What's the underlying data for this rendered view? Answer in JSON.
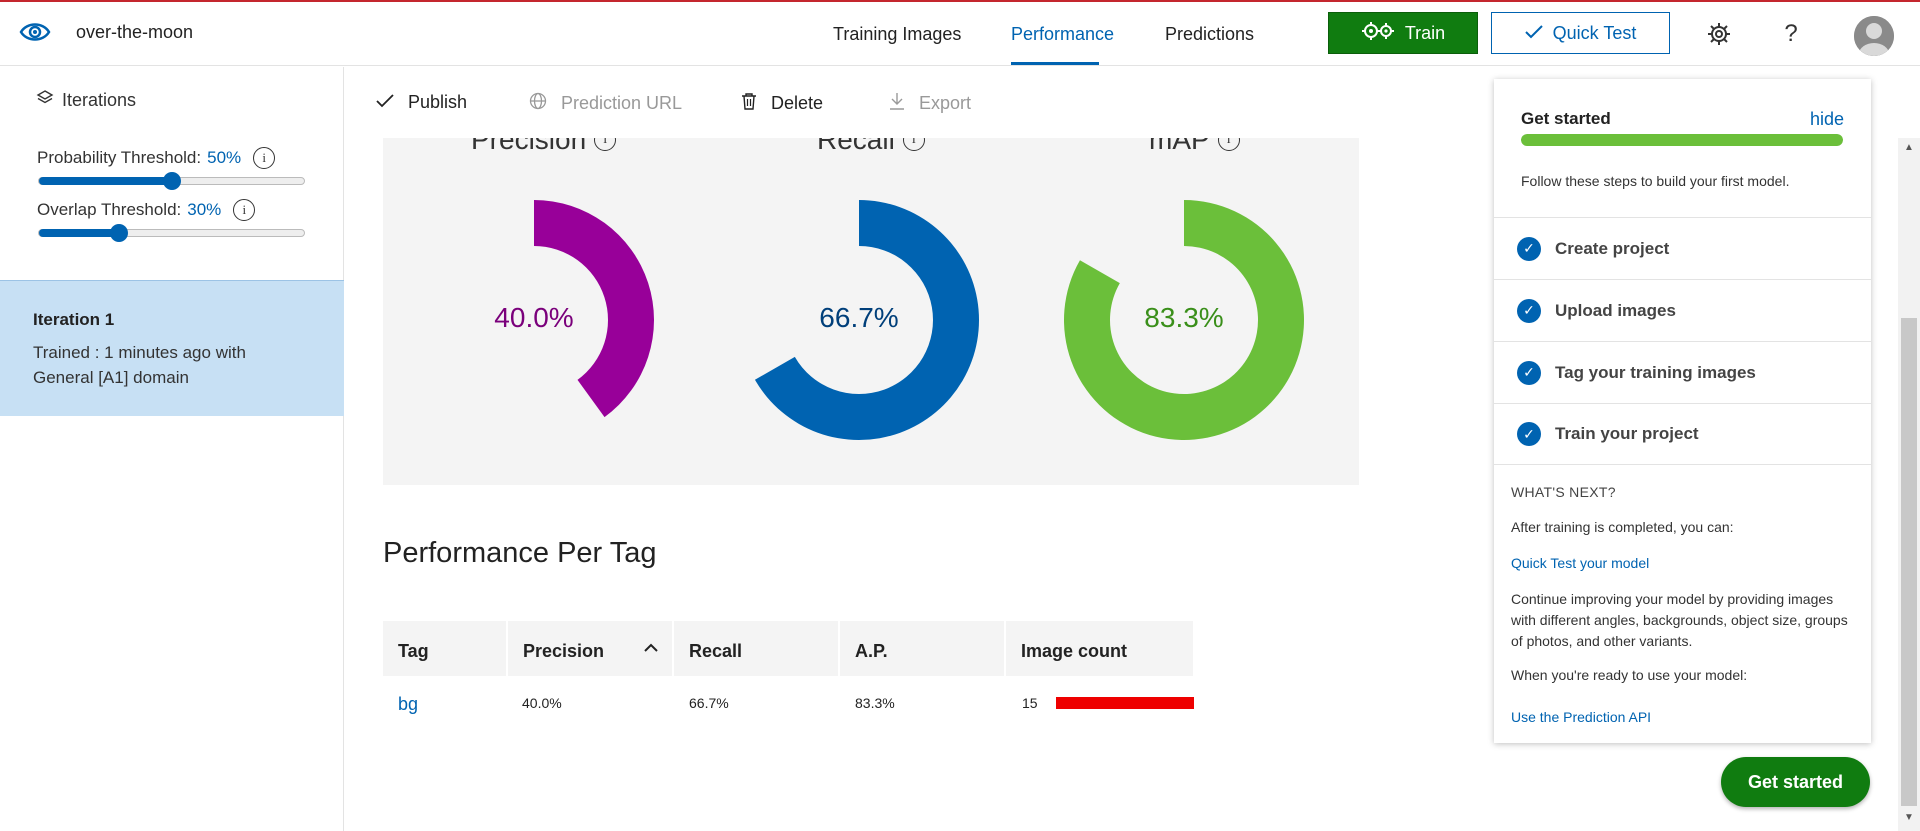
{
  "header": {
    "project_name": "over-the-moon",
    "tabs": [
      {
        "label": "Training Images"
      },
      {
        "label": "Performance"
      },
      {
        "label": "Predictions"
      }
    ],
    "train_label": "Train",
    "quick_test_label": "Quick Test",
    "icons": [
      "eye-logo-icon",
      "gears-icon",
      "check-icon",
      "gear-icon",
      "help-icon",
      "avatar"
    ]
  },
  "sidebar": {
    "iterations_label": "Iterations",
    "probability_label": "Probability Threshold:",
    "probability_value": "50%",
    "probability_level": 0.5,
    "overlap_label": "Overlap Threshold:",
    "overlap_value": "30%",
    "overlap_level": 0.3,
    "iteration": {
      "title": "Iteration 1",
      "subtitle": "Trained : 1 minutes ago with General [A1] domain"
    }
  },
  "toolbar": {
    "publish": "Publish",
    "prediction_url": "Prediction URL",
    "delete": "Delete",
    "export": "Export"
  },
  "metrics": {
    "precision": {
      "title": "Precision",
      "value_label": "40.0%",
      "fraction": 0.4,
      "color": "#980099"
    },
    "recall": {
      "title": "Recall",
      "value_label": "66.7%",
      "fraction": 0.667,
      "color": "#0063b1"
    },
    "map": {
      "title": "mAP",
      "value_label": "83.3%",
      "fraction": 0.833,
      "color": "#6bbf3a"
    }
  },
  "performance_per_tag": {
    "title": "Performance Per Tag",
    "columns": [
      "Tag",
      "Precision",
      "Recall",
      "A.P.",
      "Image count"
    ],
    "rows": [
      {
        "tag": "bg",
        "precision": "40.0%",
        "recall": "66.7%",
        "ap": "83.3%",
        "image_count": "15"
      }
    ]
  },
  "get_started": {
    "title": "Get started",
    "hide_label": "hide",
    "progress": 1.0,
    "description": "Follow these steps to build your first model.",
    "steps": [
      {
        "label": "Create project"
      },
      {
        "label": "Upload images"
      },
      {
        "label": "Tag your training images"
      },
      {
        "label": "Train your project"
      }
    ],
    "whats_next_label": "WHAT'S NEXT?",
    "after_training": "After training is completed, you can:",
    "quick_test_link": "Quick Test your model",
    "continue_text": "Continue improving your model by providing images with different angles, backgrounds, object size, groups of photos, and other variants.",
    "ready_text": "When you're ready to use your model:",
    "prediction_api_link": "Use the Prediction API",
    "button_label": "Get started"
  }
}
